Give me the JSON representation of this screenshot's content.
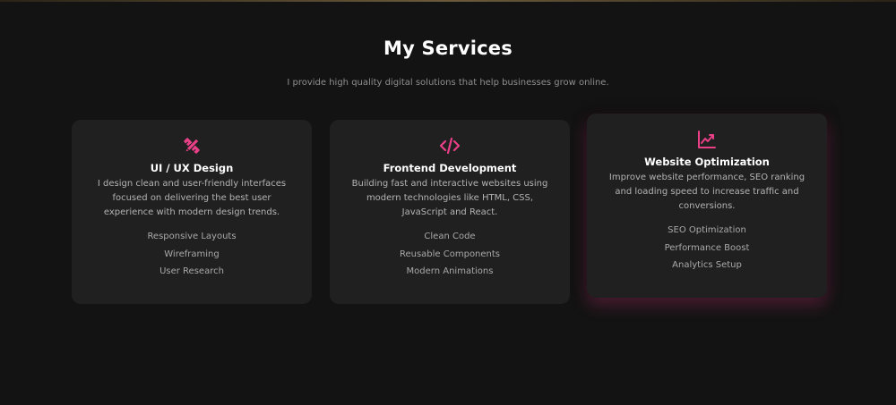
{
  "section": {
    "title": "My Services",
    "subtitle": "I provide high quality digital solutions that help businesses grow online."
  },
  "colors": {
    "background": "#131313",
    "card": "#202020",
    "accent": "#e94088",
    "text": "#ffffff",
    "muted": "#b3b3b3"
  },
  "cards": [
    {
      "icon": "pencil-ruler-icon",
      "title": "UI / UX Design",
      "description": "I design clean and user-friendly interfaces focused on delivering the best user experience with modern design trends.",
      "items": [
        "Responsive Layouts",
        "Wireframing",
        "User Research"
      ]
    },
    {
      "icon": "code-icon",
      "title": "Frontend Development",
      "description": "Building fast and interactive websites using modern technologies like HTML, CSS, JavaScript and React.",
      "items": [
        "Clean Code",
        "Reusable Components",
        "Modern Animations"
      ]
    },
    {
      "icon": "chart-line-icon",
      "title": "Website Optimization",
      "description": "Improve website performance, SEO ranking and loading speed to increase traffic and conversions.",
      "items": [
        "SEO Optimization",
        "Performance Boost",
        "Analytics Setup"
      ]
    }
  ]
}
